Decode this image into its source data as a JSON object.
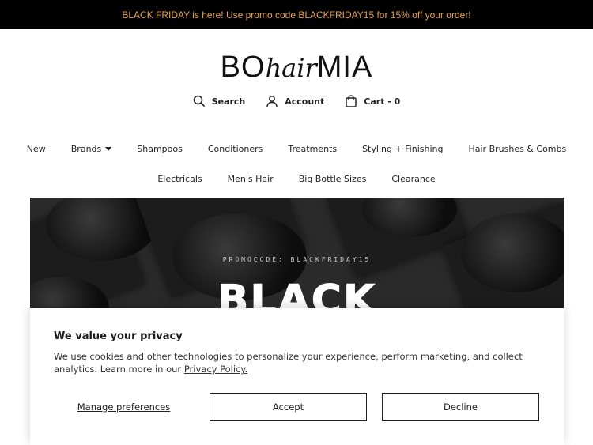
{
  "announcement": "BLACK FRIDAY is here! Use promo code BLACKFRIDAY15 for 15% off your order!",
  "logo": {
    "prefix": "BO",
    "middle": "hair",
    "suffix": "MIA"
  },
  "utility": {
    "search": "Search",
    "account": "Account",
    "cart": "Cart - 0"
  },
  "nav": {
    "row1": [
      "New",
      "Brands",
      "Shampoos",
      "Conditioners",
      "Treatments",
      "Styling + Finishing",
      "Hair Brushes & Combs"
    ],
    "row2": [
      "Electricals",
      "Men's Hair",
      "Big Bottle Sizes",
      "Clearance"
    ]
  },
  "hero": {
    "promo": "PROMOCODE: BLACKFRIDAY15",
    "title": "BLACK"
  },
  "consent": {
    "heading": "We value your privacy",
    "body": "We use cookies and other technologies to personalize your experience, perform marketing, and collect analytics. Learn more in our",
    "link": "Privacy Policy.",
    "manage": "Manage preferences",
    "accept": "Accept",
    "decline": "Decline"
  },
  "colors": {
    "announcement_bg": "#000000",
    "announcement_text": "#e8a24a"
  },
  "icons": [
    "search-icon",
    "account-icon",
    "cart-icon",
    "chevron-down-icon"
  ]
}
